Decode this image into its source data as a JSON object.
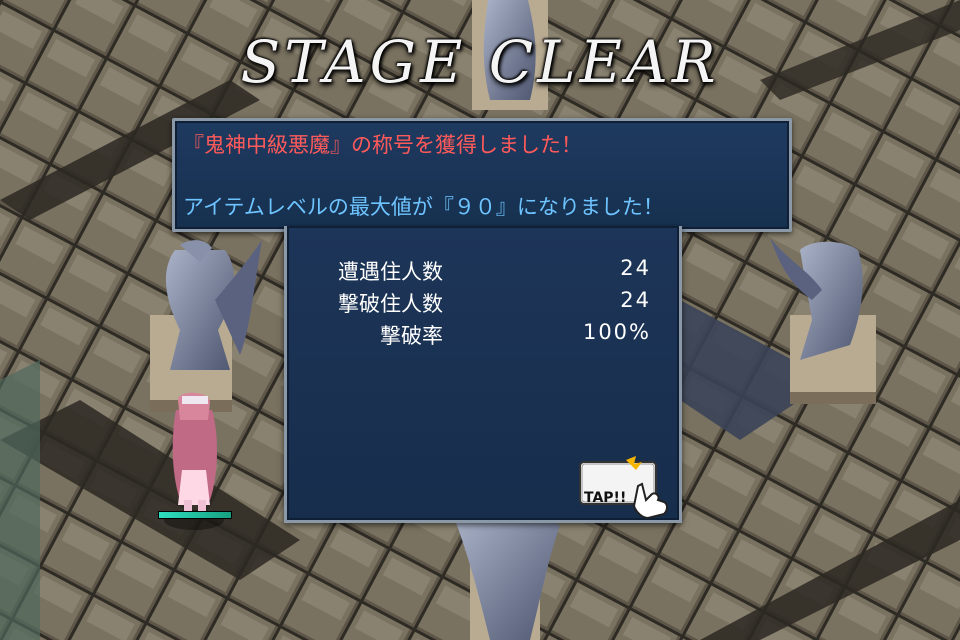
{
  "title": "STAGE CLEAR",
  "messages": {
    "title_earned": "『鬼神中級悪魔』の称号を獲得しました！",
    "item_level": "アイテムレベルの最大値が『９０』になりました！"
  },
  "stats": [
    {
      "label": "遭遇住人数",
      "value": "24"
    },
    {
      "label": "撃破住人数",
      "value": "24"
    },
    {
      "label": "撃破率",
      "value": "100%"
    }
  ],
  "tap_button": {
    "label": "TAP!!"
  },
  "player": {
    "hp_fraction": 1.0
  },
  "colors": {
    "message_red": "#ff5a5a",
    "message_blue": "#6ec4ff",
    "panel_bg": "#1f3a60",
    "panel_border": "#8a98a8"
  }
}
